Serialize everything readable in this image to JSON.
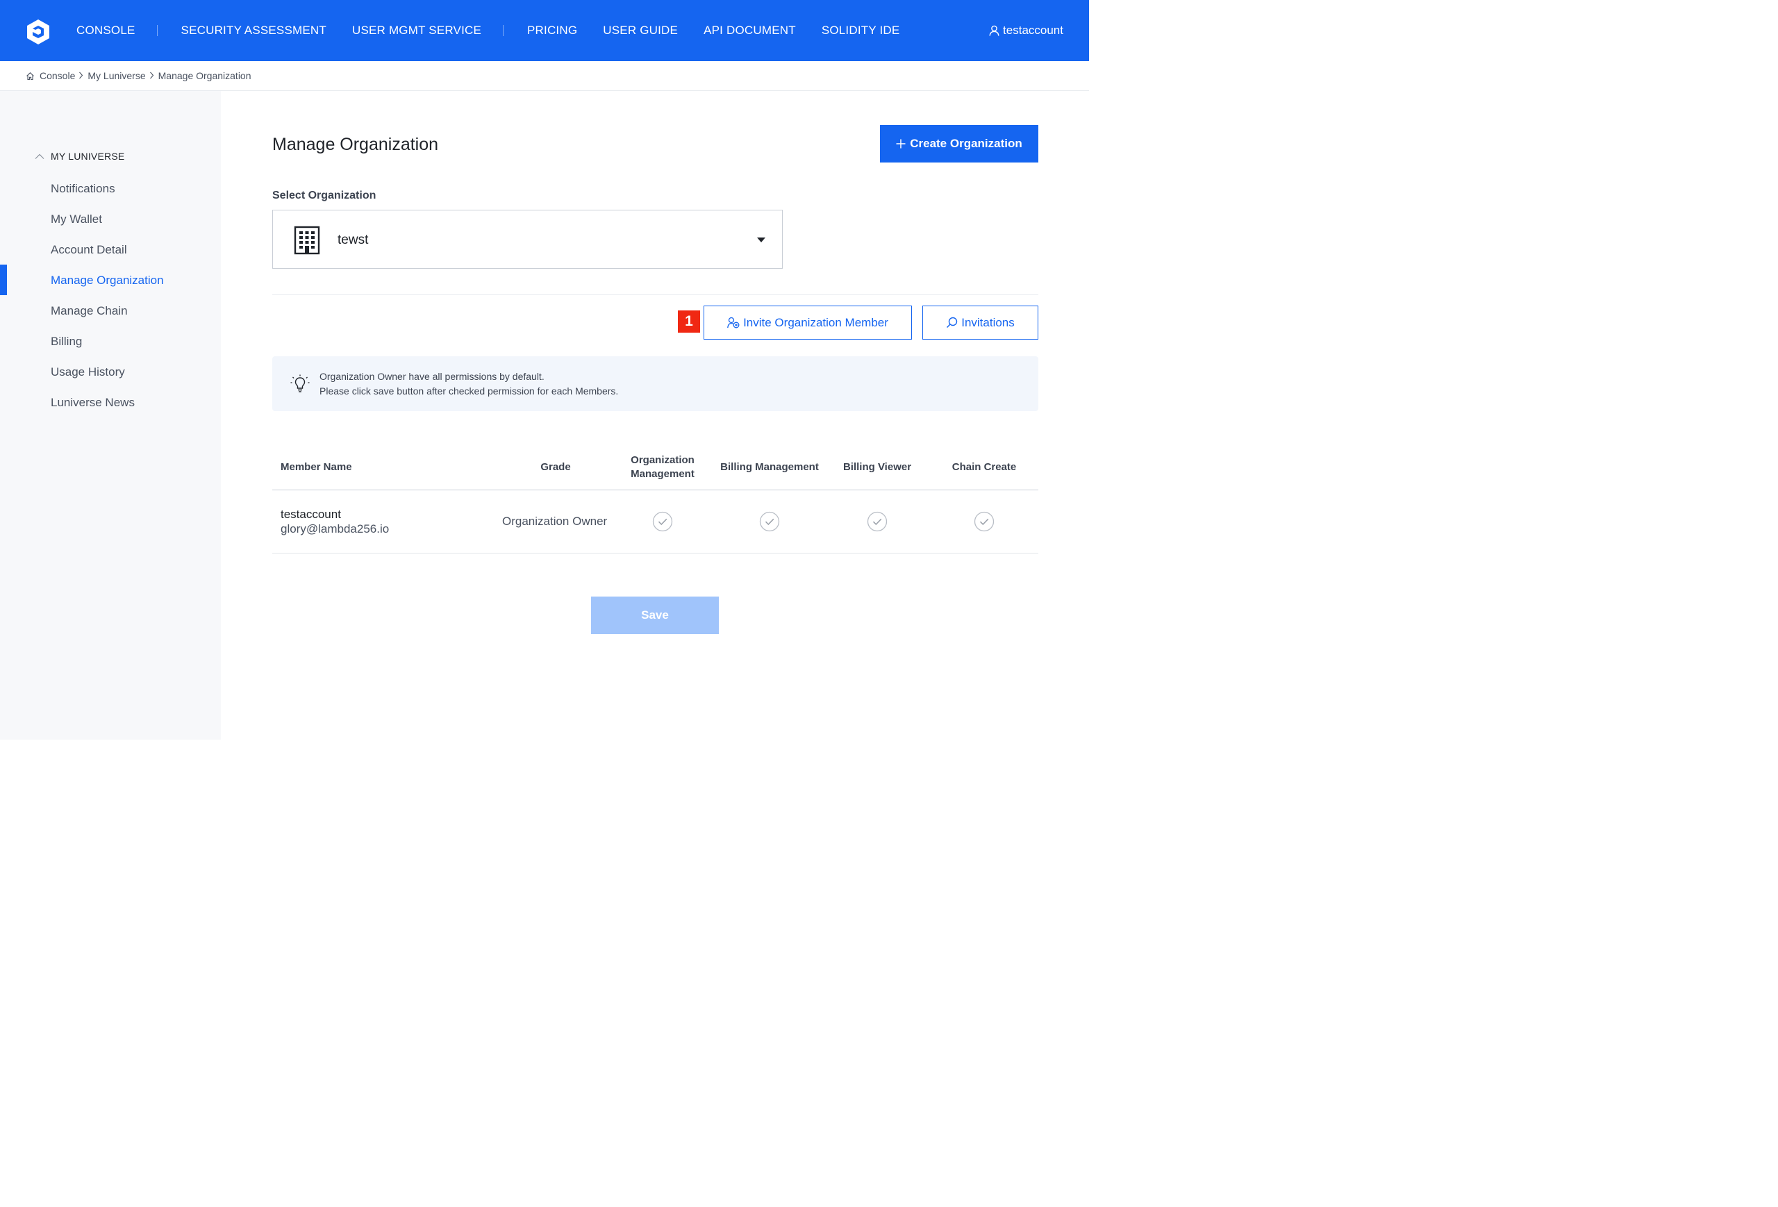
{
  "nav": {
    "items": [
      {
        "label": "CONSOLE"
      },
      {
        "label": "SECURITY ASSESSMENT"
      },
      {
        "label": "USER MGMT SERVICE"
      },
      {
        "label": "PRICING"
      },
      {
        "label": "USER GUIDE"
      },
      {
        "label": "API DOCUMENT"
      },
      {
        "label": "SOLIDITY IDE"
      }
    ],
    "user": "testaccount"
  },
  "breadcrumb": [
    "Console",
    "My Luniverse",
    "Manage Organization"
  ],
  "sidebar": {
    "section": "MY LUNIVERSE",
    "items": [
      {
        "label": "Notifications"
      },
      {
        "label": "My Wallet"
      },
      {
        "label": "Account Detail"
      },
      {
        "label": "Manage Organization",
        "active": true
      },
      {
        "label": "Manage Chain"
      },
      {
        "label": "Billing"
      },
      {
        "label": "Usage History"
      },
      {
        "label": "Luniverse News"
      }
    ]
  },
  "main": {
    "title": "Manage Organization",
    "create_button": "Create Organization",
    "select_label": "Select Organization",
    "selected_org": "tewst",
    "marker": "1",
    "invite_button": "Invite Organization Member",
    "invitations_button": "Invitations",
    "notice": [
      "Organization Owner have all permissions by default.",
      "Please click save button after checked permission for each Members."
    ],
    "table": {
      "headers": [
        "Member Name",
        "Grade",
        "Organization Management",
        "Billing Management",
        "Billing Viewer",
        "Chain Create"
      ],
      "header_lines": [
        "Organization",
        "Management"
      ],
      "rows": [
        {
          "name": "testaccount",
          "email": "glory@lambda256.io",
          "grade": "Organization Owner",
          "permissions": [
            true,
            true,
            true,
            true
          ]
        }
      ]
    },
    "save_button": "Save"
  },
  "colors": {
    "brand": "#1565f0",
    "marker": "#f02813",
    "save_disabled": "#a0c4fb"
  }
}
